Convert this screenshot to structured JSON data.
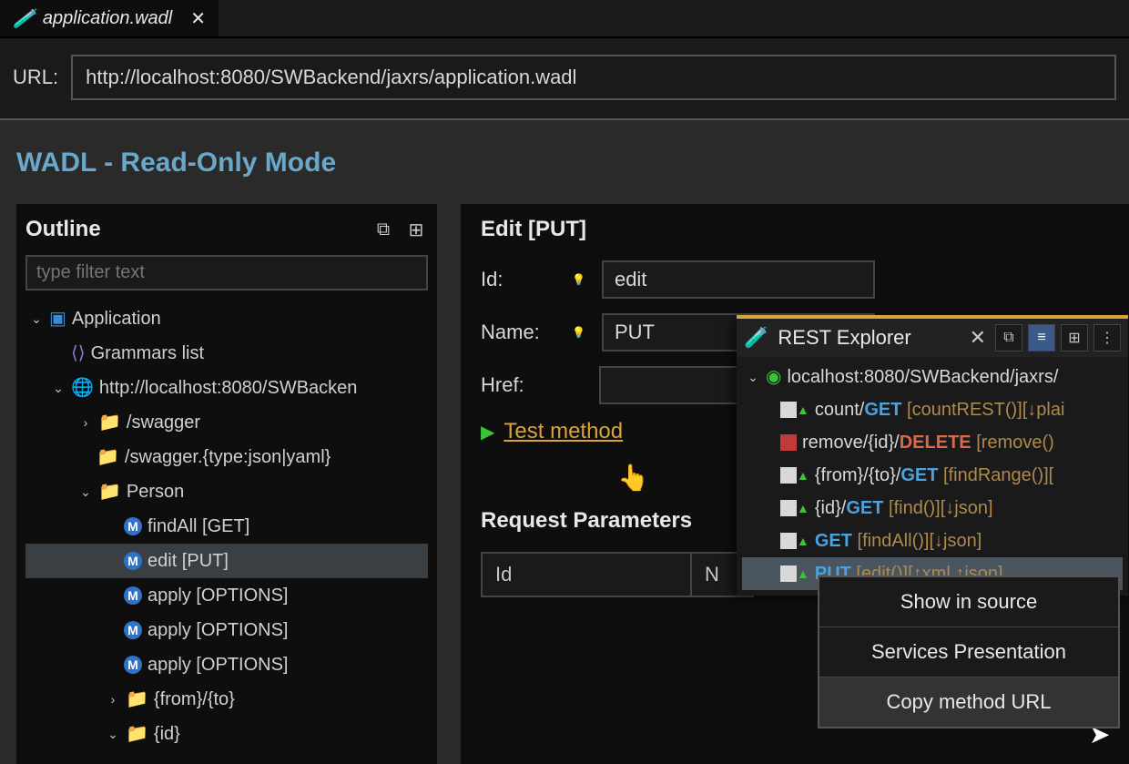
{
  "tab": {
    "title": "application.wadl"
  },
  "url": {
    "label": "URL:",
    "value": "http://localhost:8080/SWBackend/jaxrs/application.wadl"
  },
  "mode_title": "WADL - Read-Only Mode",
  "outline": {
    "title": "Outline",
    "filter_placeholder": "type filter text",
    "tree": {
      "app": "Application",
      "grammars": "Grammars list",
      "base": "http://localhost:8080/SWBacken",
      "folders": [
        "/swagger",
        "/swagger.{type:json|yaml}",
        "Person"
      ],
      "methods": [
        "findAll [GET]",
        "edit [PUT]",
        "apply [OPTIONS]",
        "apply [OPTIONS]",
        "apply [OPTIONS]"
      ],
      "subfolders": [
        "{from}/{to}",
        "{id}"
      ]
    }
  },
  "edit": {
    "title": "Edit [PUT]",
    "id_label": "Id:",
    "id_value": "edit",
    "name_label": "Name:",
    "name_value": "PUT",
    "href_label": "Href:",
    "href_value": "",
    "test_link": "Test method"
  },
  "request": {
    "title": "Request Parameters",
    "cols": [
      "Id",
      "N"
    ]
  },
  "rest": {
    "title": "REST Explorer",
    "root": "localhost:8080/SWBackend/jaxrs/",
    "endpoints": [
      {
        "path": "count/",
        "method": "GET",
        "detail": " [countREST()][↓plai"
      },
      {
        "path": "remove/{id}/",
        "method": "DELETE",
        "detail": " [remove()",
        "del": true
      },
      {
        "path": "{from}/{to}/",
        "method": "GET",
        "detail": " [findRange()]["
      },
      {
        "path": "{id}/",
        "method": "GET",
        "detail": " [find()][↓json]"
      },
      {
        "path": "",
        "method": "GET",
        "detail": " [findAll()][↓json]"
      },
      {
        "path": "",
        "method": "PUT",
        "detail": " [edit()][↑xml ↑json]",
        "selected": true
      }
    ]
  },
  "context_menu": {
    "items": [
      "Show in source",
      "Services Presentation",
      "Copy method URL"
    ]
  }
}
